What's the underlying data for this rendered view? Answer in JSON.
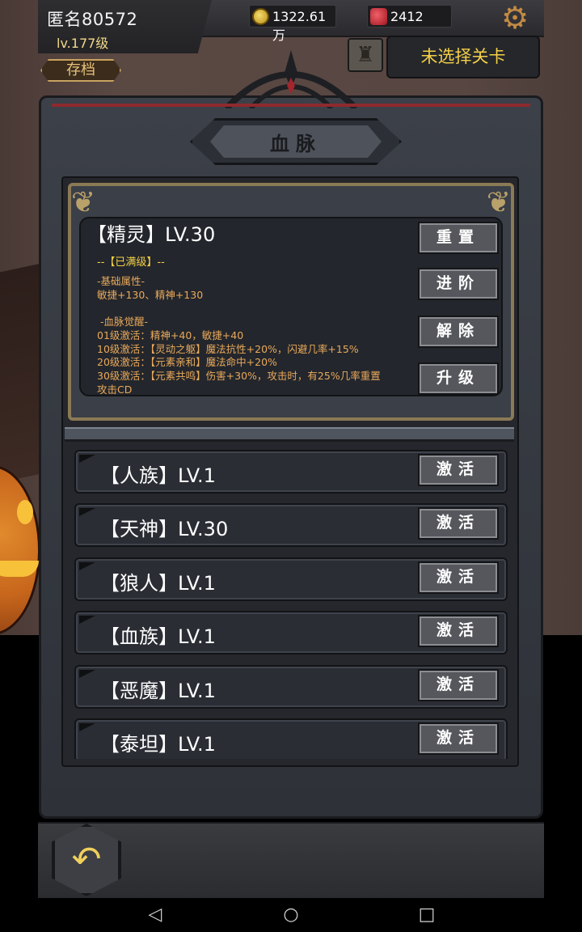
{
  "player": {
    "name": "匿名80572",
    "level": "lv.177级",
    "save_label": "存档"
  },
  "resources": {
    "gold": "1322.61万",
    "gems": "2412"
  },
  "stage": {
    "label": "未选择关卡"
  },
  "panel": {
    "title": "血脉"
  },
  "featured": {
    "name": "【精灵】LV.30",
    "status": "--【已满级】--",
    "base_header": "-基础属性-",
    "base_stats": "敏捷+130、精神+130",
    "awaken_header": "-血脉觉醒-",
    "awaken_lines": [
      "01级激活：精神+40，敏捷+40",
      "10级激活：【灵动之躯】魔法抗性+20%，闪避几率+15%",
      "20级激活：【元素亲和】魔法命中+20%",
      "30级激活：【元素共鸣】伤害+30%，攻击时，有25%几率重置",
      "攻击CD"
    ],
    "buttons": {
      "reset": "重置",
      "advance": "进阶",
      "remove": "解除",
      "upgrade": "升级"
    }
  },
  "bloodlines": [
    {
      "label": "【人族】LV.1",
      "button": "激活"
    },
    {
      "label": "【天神】LV.30",
      "button": "激活"
    },
    {
      "label": "【狼人】LV.1",
      "button": "激活"
    },
    {
      "label": "【血族】LV.1",
      "button": "激活"
    },
    {
      "label": "【恶魔】LV.1",
      "button": "激活"
    },
    {
      "label": "【泰坦】LV.1",
      "button": "激活"
    }
  ],
  "icons": {
    "settings": "gear-icon",
    "stage": "stage-map-icon",
    "back": "back-arrow-icon",
    "gold": "gold-coin-icon",
    "gem": "red-gem-icon"
  }
}
